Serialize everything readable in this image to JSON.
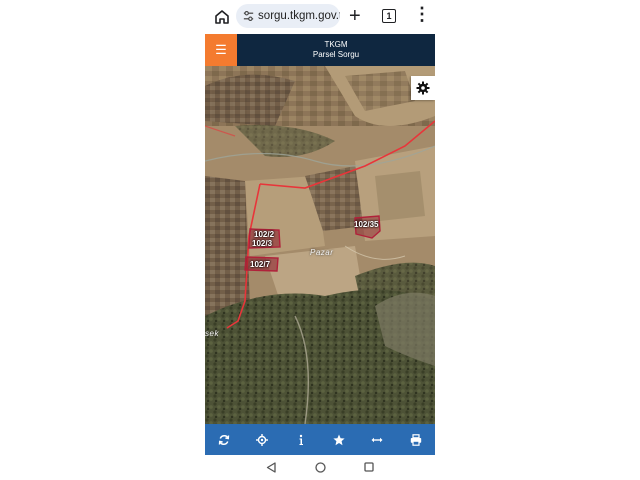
{
  "browser": {
    "url": "sorgu.tkgm.gov.tr",
    "tab_count": "1"
  },
  "header": {
    "title": "TKGM",
    "subtitle": "Parsel Sorgu"
  },
  "map": {
    "parcels": [
      {
        "label": "102/2"
      },
      {
        "label": "102/3"
      },
      {
        "label": "102/7"
      },
      {
        "label": "102/35"
      }
    ],
    "place_labels": [
      "Pazar",
      "sek"
    ]
  },
  "toolbar": {
    "items": [
      "refresh-icon",
      "locate-icon",
      "info-icon",
      "star-icon",
      "measure-icon",
      "print-icon"
    ]
  },
  "colors": {
    "header_bg": "#0f2740",
    "menu_accent": "#f47b2f",
    "toolbar_bg": "#2b6cb3",
    "boundary_line": "#e8353a",
    "parcel_fill": "#8b1a2a"
  }
}
